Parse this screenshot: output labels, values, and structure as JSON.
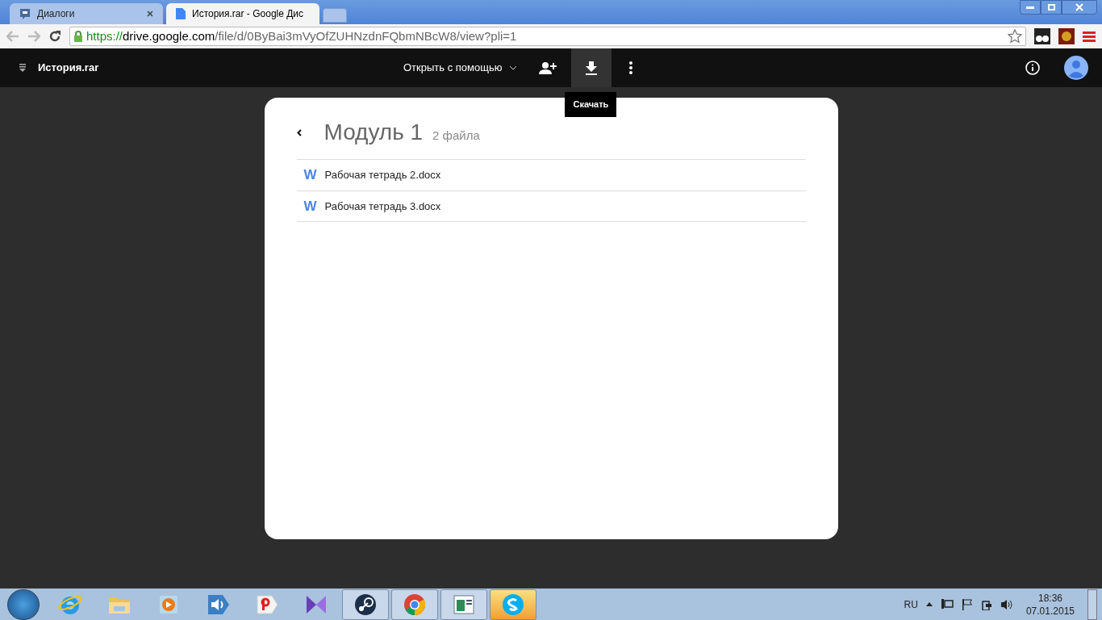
{
  "browser": {
    "tabs": [
      {
        "title": "Диалоги",
        "kind": "chat",
        "selected": false
      },
      {
        "title": "История.rar - Google Дис",
        "kind": "doc",
        "selected": true
      }
    ],
    "url": {
      "scheme": "https://",
      "host": "drive.google.com",
      "path": "/file/d/0ByBai3mVyOfZUHNzdnFQbmNBcW8/view?pli=1"
    }
  },
  "drive_bar": {
    "file_name": "История.rar",
    "open_with": "Открыть с помощью",
    "tooltip": "Скачать"
  },
  "folder": {
    "title": "Модуль 1",
    "count": "2 файла",
    "files": [
      {
        "name": "Рабочая тетрадь 2.docx",
        "icon_text": "W"
      },
      {
        "name": "Рабочая тетрадь 3.docx",
        "icon_text": "W"
      }
    ]
  },
  "taskbar": {
    "apps": [
      {
        "kind": "ie",
        "running": false,
        "highlighted": false
      },
      {
        "kind": "folder",
        "running": false,
        "highlighted": false
      },
      {
        "kind": "player",
        "running": false,
        "highlighted": false
      },
      {
        "kind": "sound",
        "running": false,
        "highlighted": false
      },
      {
        "kind": "yandex",
        "running": false,
        "highlighted": false
      },
      {
        "kind": "bowtie",
        "running": false,
        "highlighted": false
      },
      {
        "kind": "steam",
        "running": true,
        "highlighted": false
      },
      {
        "kind": "chrome",
        "running": true,
        "highlighted": false
      },
      {
        "kind": "window",
        "running": true,
        "highlighted": false
      },
      {
        "kind": "skype",
        "running": true,
        "highlighted": true
      }
    ],
    "language": "RU",
    "time": "18:36",
    "date": "07.01.2015"
  }
}
